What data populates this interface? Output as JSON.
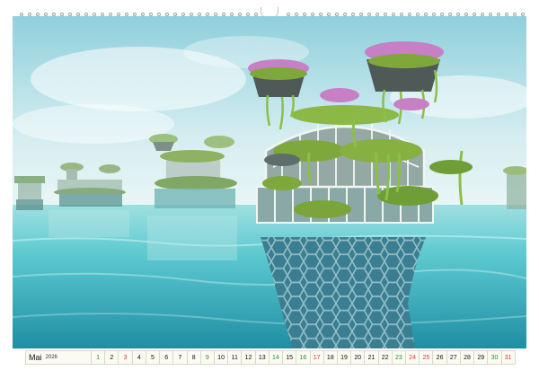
{
  "calendar": {
    "month": "Mai",
    "year": "2026",
    "days": [
      {
        "n": "1",
        "kind": "hol"
      },
      {
        "n": "2",
        "kind": "norm"
      },
      {
        "n": "3",
        "kind": "sun"
      },
      {
        "n": "4",
        "kind": "norm"
      },
      {
        "n": "5",
        "kind": "norm"
      },
      {
        "n": "6",
        "kind": "norm"
      },
      {
        "n": "7",
        "kind": "norm"
      },
      {
        "n": "8",
        "kind": "norm"
      },
      {
        "n": "9",
        "kind": "hol"
      },
      {
        "n": "10",
        "kind": "norm"
      },
      {
        "n": "11",
        "kind": "norm"
      },
      {
        "n": "12",
        "kind": "norm"
      },
      {
        "n": "13",
        "kind": "norm"
      },
      {
        "n": "14",
        "kind": "hol"
      },
      {
        "n": "15",
        "kind": "norm"
      },
      {
        "n": "16",
        "kind": "hol"
      },
      {
        "n": "17",
        "kind": "sun"
      },
      {
        "n": "18",
        "kind": "norm"
      },
      {
        "n": "19",
        "kind": "norm"
      },
      {
        "n": "20",
        "kind": "norm"
      },
      {
        "n": "21",
        "kind": "norm"
      },
      {
        "n": "22",
        "kind": "norm"
      },
      {
        "n": "23",
        "kind": "hol"
      },
      {
        "n": "24",
        "kind": "sun"
      },
      {
        "n": "25",
        "kind": "sun"
      },
      {
        "n": "26",
        "kind": "norm"
      },
      {
        "n": "27",
        "kind": "norm"
      },
      {
        "n": "28",
        "kind": "norm"
      },
      {
        "n": "29",
        "kind": "norm"
      },
      {
        "n": "30",
        "kind": "hol"
      },
      {
        "n": "31",
        "kind": "sun"
      }
    ]
  },
  "colors": {
    "sky_top": "#8fd0dc",
    "sky_bottom": "#e6f3f4",
    "water_top": "#7fd3d9",
    "water_bottom": "#1e8fa2",
    "foliage": "#7fa83c",
    "flowers": "#c77fc6",
    "weekday_green": "#2c8c3c",
    "sunday_red": "#d2432b"
  }
}
